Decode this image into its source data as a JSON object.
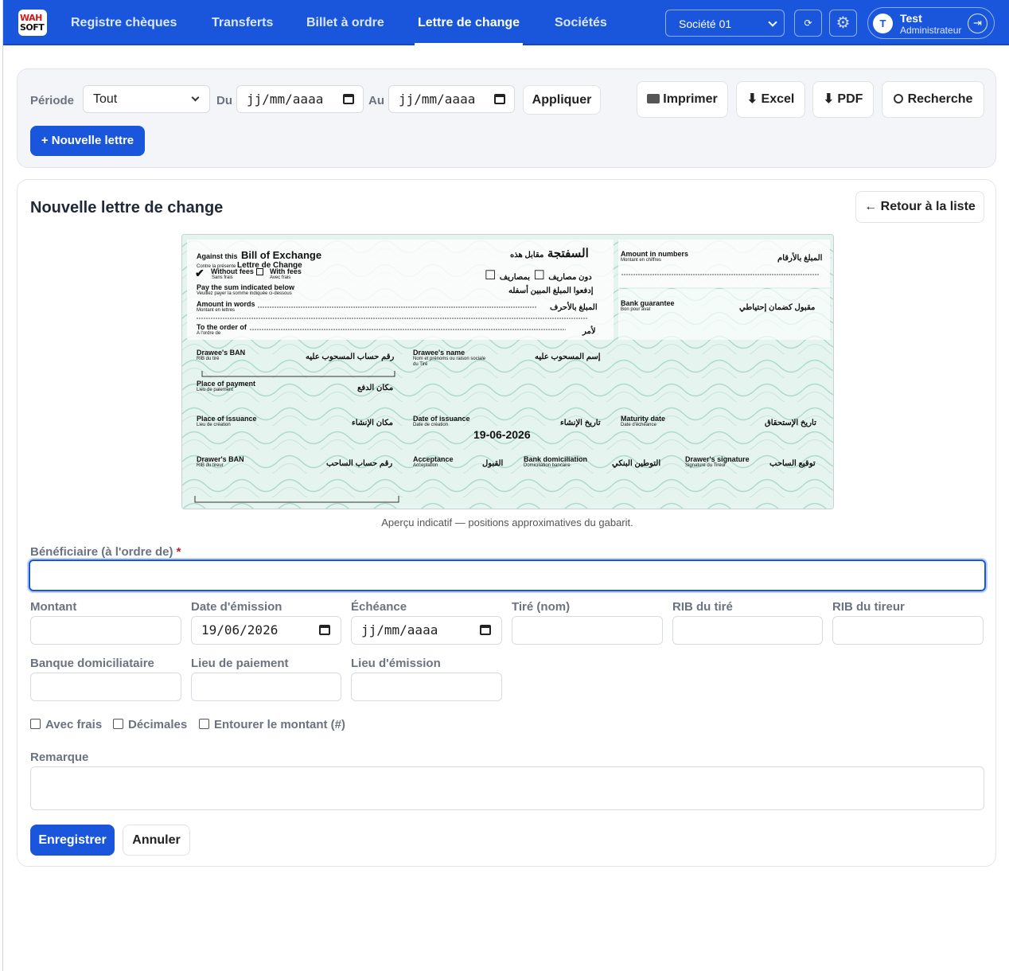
{
  "app": {
    "logo_top": "WAH",
    "logo_bottom": "SOFT"
  },
  "nav": {
    "items": [
      "Registre chèques",
      "Transferts",
      "Billet à ordre",
      "Lettre de change",
      "Sociétés"
    ],
    "active": "Lettre de change"
  },
  "header": {
    "company_select": "Société 01",
    "refresh_icon": "⟳",
    "settings_icon": "⚙",
    "user_initial": "T",
    "user_name": "Test",
    "user_role": "Administrateur",
    "logout_icon": "⇥"
  },
  "toolbar": {
    "periode_label": "Période",
    "periode_value": "Tout",
    "du_label": "Du",
    "du_value": "jj/mm/aaaa",
    "au_label": "Au",
    "au_value": "jj/mm/aaaa",
    "apply": "Appliquer",
    "print": "Imprimer",
    "excel": "Excel",
    "pdf": "PDF",
    "search": "Recherche",
    "new": "+ Nouvelle lettre"
  },
  "form": {
    "title": "Nouvelle lettre de change",
    "back": "← Retour à la liste",
    "caption": "Aperçu indicatif — positions approximatives du gabarit.",
    "beneficiaire_label": "Bénéficiaire (à l'ordre de)",
    "required_mark": "*",
    "montant_label": "Montant",
    "date_emission_label": "Date d'émission",
    "date_emission_value": "19/06/2026",
    "echeance_label": "Échéance",
    "echeance_value": "jj/mm/aaaa",
    "tire_label": "Tiré (nom)",
    "rib_tire_label": "RIB du tiré",
    "rib_tireur_label": "RIB du tireur",
    "banque_label": "Banque domiciliataire",
    "lieu_paiement_label": "Lieu de paiement",
    "lieu_emission_label": "Lieu d'émission",
    "avec_frais": "Avec frais",
    "decimales": "Décimales",
    "entourer": "Entourer le montant (#)",
    "remarque_label": "Remarque",
    "save": "Enregistrer",
    "cancel": "Annuler"
  },
  "check": {
    "against": "Against this",
    "boe": "Bill of Exchange",
    "contre": "Contre la présente",
    "lettre": "Lettre de Change",
    "ar_title": "السفتجة",
    "ar_against": "مقابل هذه",
    "without_fees": "Without fees",
    "sans_frais": "Sans frais",
    "with_fees": "With fees",
    "avec_frais": "Avec frais",
    "ar_without": "دون مصاريف",
    "ar_with": "بمصاريف",
    "pay_sum": "Pay the sum indicated below",
    "veuillez": "Veuillez payer la somme indiquée ci-dessous",
    "ar_pay": "إدفعوا المبلغ المبين أسفله",
    "amount_words": "Amount in words",
    "montant_lettres": "Montant en lettres",
    "ar_amount_words": "المبلغ بالأحرف",
    "to_order": "To the order of",
    "ordre": "A l'ordre de",
    "ar_order": "لأمر",
    "amount_numbers": "Amount in numbers",
    "montant_chiffres": "Montant en chiffres",
    "ar_amount_numbers": "المبلغ بالأرقام",
    "bank_guarantee": "Bank guarantee",
    "bon_aval": "Bon pour aval",
    "ar_guarantee": "مقبول كضمان إحتياطي",
    "drawee_ban": "Drawee's BAN",
    "rib_tire": "RIB du tiré",
    "ar_drawee_ban": "رقم حساب المسحوب عليه",
    "drawee_name": "Drawee's name",
    "nom_prenoms": "Nom et prénoms ou raison sociale",
    "du_tire": "du Tiré",
    "ar_drawee_name": "إسم المسحوب عليه",
    "place_payment": "Place of payment",
    "lieu_paiement": "Lieu de paiement",
    "ar_place_payment": "مكان الدفع",
    "place_issuance": "Place of issuance",
    "lieu_creation": "Lieu de création",
    "ar_place_issuance": "مكان الإنشاء",
    "date_issuance": "Date of issuance",
    "date_creation": "Date de création",
    "ar_date_issuance": "تاريخ الإنشاء",
    "date_value": "19-06-2026",
    "maturity": "Maturity date",
    "date_echeance": "Date d'échéance",
    "ar_maturity": "تاريخ الإستحقاق",
    "drawer_ban": "Drawer's BAN",
    "rib_tireur": "RIB du tireur",
    "ar_drawer_ban": "رقم حساب الساحب",
    "acceptance": "Acceptance",
    "acceptation": "Acceptation",
    "ar_acceptance": "القبول",
    "bank_dom": "Bank domiciliation",
    "dom_bancaire": "Domiciliation bancaire",
    "ar_bank_dom": "التوطين البنكي",
    "drawer_sig": "Drawer's signature",
    "sig_tireur": "Signature du Tireur",
    "ar_drawer_sig": "توقيع الساحب"
  },
  "colors": {
    "primary": "#1a56db",
    "check_bg": "#dff0ea"
  }
}
